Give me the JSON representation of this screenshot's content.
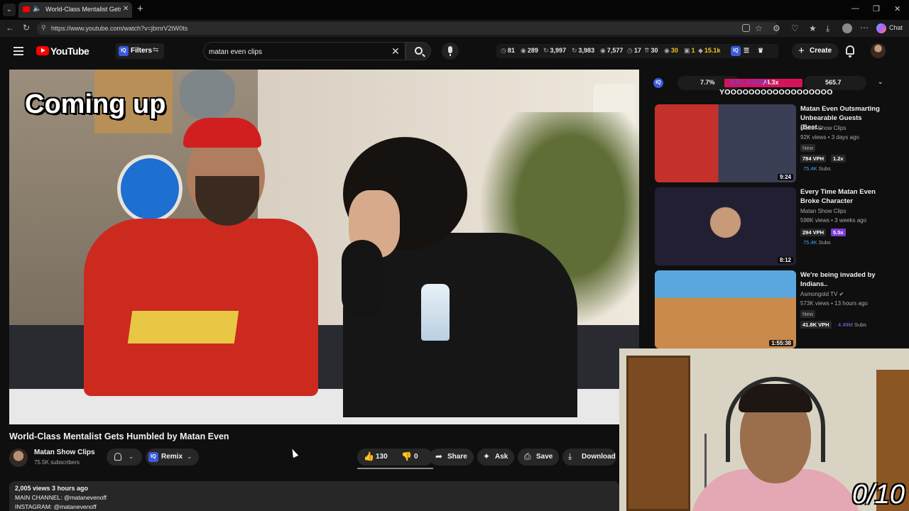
{
  "browser": {
    "tab_title": "World-Class Mentalist Gets Humbled by Matan Even",
    "url": "https://www.youtube.com/watch?v=jbmrV2tW0ts",
    "chat_label": "Chat"
  },
  "header": {
    "logo_text": "YouTube",
    "filters_label": "Filters",
    "search_value": "matan even clips",
    "stats": {
      "s1": "81",
      "s2": "289",
      "s3": "3,997",
      "s4": "3,983",
      "s5": "7,577",
      "s6": "17",
      "s7": "30",
      "s8": "30",
      "s9": "1",
      "s10": "15.1k"
    },
    "create_label": "Create"
  },
  "video": {
    "caption": "Coming up",
    "title": "World-Class Mentalist Gets Humbled by Matan Even",
    "channel_name": "Matan Show Clips",
    "channel_subs": "75.5K subscribers",
    "remix_label": "Remix",
    "like_count": "130",
    "dislike_count": "0",
    "share_label": "Share",
    "ask_label": "Ask",
    "save_label": "Save",
    "download_label": "Download",
    "description": {
      "meta": "2,005 views  3 hours ago",
      "line1": "MAIN CHANNEL:  @matanevenoff",
      "line2": "INSTAGRAM: @matanevenoff"
    }
  },
  "sidebar": {
    "iq_pct": "7.7%",
    "iq_multiplier": "24.3x",
    "iq_value": "565.7",
    "stream_chat": {
      "name": "BALAGNO",
      "message": "YOOOOOOOOOOOOOOOOOO"
    },
    "recommendations": [
      {
        "title": "Matan Even Outsmarting Unbearable Guests (Best...",
        "channel": "Matan Show Clips",
        "meta": "92K views • 3 days ago",
        "badge": "New",
        "vph": "784 VPH",
        "mult": "1.2x",
        "subs": "75.4K",
        "subs_label": "Subs",
        "duration": "9:24"
      },
      {
        "title": "Every Time Matan Even Broke Character",
        "channel": "Matan Show Clips",
        "meta": "598K views • 3 weeks ago",
        "vph": "294 VPH",
        "mult": "5.5x",
        "subs": "75.4K",
        "subs_label": "Subs",
        "duration": "8:12"
      },
      {
        "title": "We're being invaded by Indians..",
        "channel": "Asmongold TV",
        "meta": "573K views • 13 hours ago",
        "badge": "New",
        "vph": "41.8K VPH",
        "subs": "4.49M",
        "subs_label": "Subs",
        "duration": "1:55:38"
      }
    ]
  },
  "webcam": {
    "score": "0/10"
  }
}
